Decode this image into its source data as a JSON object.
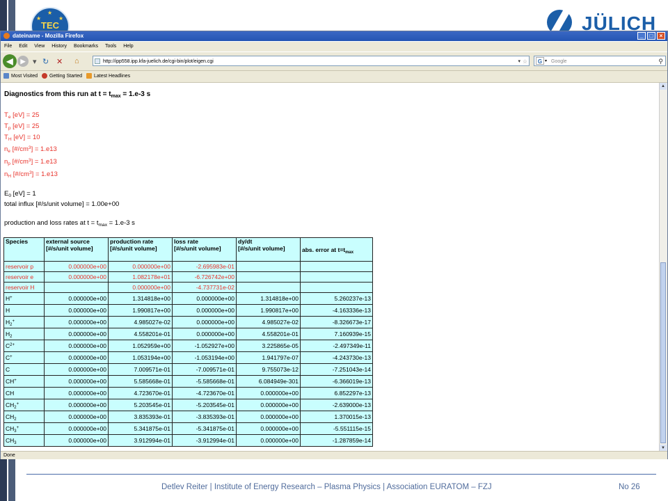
{
  "slide": {
    "tec_logo_text": "TEC",
    "julich_logo_text": "JÜLICH",
    "footer_text": "Detlev Reiter | Institute of Energy Research – Plasma Physics | Association EURATOM – FZJ",
    "footer_page": "No 26"
  },
  "browser": {
    "title": "dateiname - Mozilla Firefox",
    "menu": [
      "File",
      "Edit",
      "View",
      "History",
      "Bookmarks",
      "Tools",
      "Help"
    ],
    "url": "http://ipp558.ipp.kfa-juelich.de/cgi-bin/plot/eigen.cgi",
    "search_placeholder": "Google",
    "search_engine_letter": "G",
    "bookmarks": [
      "Most Visited",
      "Getting Started",
      "Latest Headlines"
    ],
    "status": "Done"
  },
  "page": {
    "diag_prefix": "Diagnostics from this run at t = t",
    "diag_sub": "max",
    "diag_suffix": " = 1.e-3 s",
    "params": [
      {
        "sym": "T",
        "sub": "e",
        "mid": " [eV] = 25",
        "sup": "",
        "tail": ""
      },
      {
        "sym": "T",
        "sub": "p",
        "mid": " [eV] = 25",
        "sup": "",
        "tail": ""
      },
      {
        "sym": "T",
        "sub": "H",
        "mid": " [eV] = 10",
        "sup": "",
        "tail": ""
      },
      {
        "sym": "n",
        "sub": "e",
        "mid": " [#/cm",
        "sup": "3",
        "tail": "] = 1.e13"
      },
      {
        "sym": "n",
        "sub": "p",
        "mid": " [#/cm",
        "sup": "3",
        "tail": "] = 1.e13"
      },
      {
        "sym": "n",
        "sub": "H",
        "mid": " [#/cm",
        "sup": "3",
        "tail": "] = 1.e13"
      }
    ],
    "e0_sym": "E",
    "e0_sub": "0",
    "e0_rest": " [eV] = 1",
    "influx": "total influx [#/s/unit volume] = 1.00e+00",
    "rates_prefix": "production and loss rates at t = t",
    "rates_sub": "max",
    "rates_suffix": " = 1.e-3 s"
  },
  "table": {
    "headers": [
      {
        "l1": "Species",
        "l2": ""
      },
      {
        "l1": "external source",
        "l2": "[#/s/unit volume]"
      },
      {
        "l1": "production rate",
        "l2": "[#/s/unit volume]"
      },
      {
        "l1": "loss rate",
        "l2": "[#/s/unit volume]"
      },
      {
        "l1": "dy/dt",
        "l2": "[#/s/unit volume]"
      }
    ],
    "err_header_prefix": "abs. error at t=t",
    "err_header_sub": "max",
    "reservoir_rows": [
      {
        "name": "reservoir p",
        "ext": "0.000000e+00",
        "prod": "0.000000e+00",
        "loss": "-2.695983e-01"
      },
      {
        "name": "reservoir e",
        "ext": "0.000000e+00",
        "prod": "1.082178e+01",
        "loss": "-6.726742e+00"
      },
      {
        "name": "reservoir H",
        "ext": "",
        "prod": "0.000000e+00",
        "loss": "-4.737731e-02"
      }
    ],
    "rows": [
      {
        "base": "H",
        "sub": "",
        "sup": "+",
        "ext": "0.000000e+00",
        "prod": "1.314818e+00",
        "loss": "0.000000e+00",
        "dydt": "1.314818e+00",
        "err": "5.260237e-13"
      },
      {
        "base": "H",
        "sub": "",
        "sup": "",
        "ext": "0.000000e+00",
        "prod": "1.990817e+00",
        "loss": "0.000000e+00",
        "dydt": "1.990817e+00",
        "err": "-4.163336e-13"
      },
      {
        "base": "H",
        "sub": "2",
        "sup": "+",
        "ext": "0.000000e+00",
        "prod": "4.985027e-02",
        "loss": "0.000000e+00",
        "dydt": "4.985027e-02",
        "err": "-8.326673e-17"
      },
      {
        "base": "H",
        "sub": "2",
        "sup": "",
        "ext": "0.000000e+00",
        "prod": "4.558201e-01",
        "loss": "0.000000e+00",
        "dydt": "4.558201e-01",
        "err": "7.160939e-15"
      },
      {
        "base": "C",
        "sub": "",
        "sup": "2+",
        "ext": "0.000000e+00",
        "prod": "1.052959e+00",
        "loss": "-1.052927e+00",
        "dydt": "3.225865e-05",
        "err": "-2.497349e-11"
      },
      {
        "base": "C",
        "sub": "",
        "sup": "+",
        "ext": "0.000000e+00",
        "prod": "1.053194e+00",
        "loss": "-1.053194e+00",
        "dydt": "1.941797e-07",
        "err": "-4.243730e-13"
      },
      {
        "base": "C",
        "sub": "",
        "sup": "",
        "ext": "0.000000e+00",
        "prod": "7.009571e-01",
        "loss": "-7.009571e-01",
        "dydt": "9.755073e-12",
        "err": "-7.251043e-14"
      },
      {
        "base": "CH",
        "sub": "",
        "sup": "+",
        "ext": "0.000000e+00",
        "prod": "5.585668e-01",
        "loss": "-5.585668e-01",
        "dydt": "6.084949e-301",
        "err": "-6.366019e-13"
      },
      {
        "base": "CH",
        "sub": "",
        "sup": "",
        "ext": "0.000000e+00",
        "prod": "4.723670e-01",
        "loss": "-4.723670e-01",
        "dydt": "0.000000e+00",
        "err": "6.852297e-13"
      },
      {
        "base": "CH",
        "sub": "2",
        "sup": "+",
        "ext": "0.000000e+00",
        "prod": "5.203545e-01",
        "loss": "-5.203545e-01",
        "dydt": "0.000000e+00",
        "err": "-2.639000e-13"
      },
      {
        "base": "CH",
        "sub": "2",
        "sup": "",
        "ext": "0.000000e+00",
        "prod": "3.835393e-01",
        "loss": "-3.835393e-01",
        "dydt": "0.000000e+00",
        "err": "1.370015e-13"
      },
      {
        "base": "CH",
        "sub": "3",
        "sup": "+",
        "ext": "0.000000e+00",
        "prod": "5.341875e-01",
        "loss": "-5.341875e-01",
        "dydt": "0.000000e+00",
        "err": "-5.551115e-15"
      },
      {
        "base": "CH",
        "sub": "3",
        "sup": "",
        "ext": "0.000000e+00",
        "prod": "3.912994e-01",
        "loss": "-3.912994e-01",
        "dydt": "0.000000e+00",
        "err": "-1.287859e-14"
      }
    ]
  }
}
